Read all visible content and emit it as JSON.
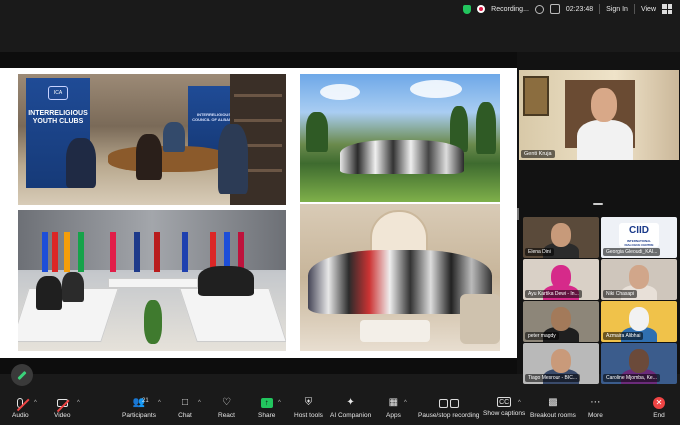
{
  "topbar": {
    "recording_label": "Recording...",
    "timer": "02:23:48",
    "sign_in": "Sign In",
    "view": "View"
  },
  "slide": {
    "banner_left_logo": "ICA",
    "banner_left_text": "INTERRELIGIOUS YOUTH CLUBS",
    "banner_right_text": "INTERRELIGIOUS COUNCIL OF ALBANIA"
  },
  "spotlight": {
    "name": "Genti Kruja"
  },
  "participants": [
    {
      "name": "Elena Dini",
      "bg": "#5a4a3a",
      "face": "#c79a7a",
      "body": "#2b2b2b"
    },
    {
      "name": "Georgia Gleoudi_KAI...",
      "bg": "#eef1f6",
      "logo": "CIID",
      "logo_sub": "INTERNATIONAL DIALOGUE CENTRE"
    },
    {
      "name": "Ayu Kartika Dewi - In...",
      "bg": "#d9d0c6",
      "face": "#d62a8a",
      "body": "#d62a8a"
    },
    {
      "name": "Niki Chasapi",
      "bg": "#cfc6bc",
      "face": "#d1a68a",
      "body": "#e8e0d8"
    },
    {
      "name": "peter magdy",
      "bg": "#8d8679",
      "face": "#a37a5a",
      "body": "#1f1f1f"
    },
    {
      "name": "Azmaira Alibhai",
      "bg": "#f0c24a",
      "face": "#f2f2f2",
      "body": "#2f6fb0"
    },
    {
      "name": "Tiago Mesrour - BIC...",
      "bg": "#b9b9b9",
      "face": "#c99a7a",
      "body": "#3a4b6b"
    },
    {
      "name": "Caroline Mjomba, Ke...",
      "bg": "#3b5c8c",
      "face": "#6b4a3a",
      "body": "#6b2b7a"
    }
  ],
  "toolbar": {
    "audio": "Audio",
    "video": "Video",
    "participants": "Participants",
    "participants_count": "21",
    "chat": "Chat",
    "react": "React",
    "share": "Share",
    "host_tools": "Host tools",
    "ai_companion": "AI Companion",
    "apps": "Apps",
    "pause_stop": "Pause/stop recording",
    "captions": "Show captions",
    "breakout": "Breakout rooms",
    "more": "More",
    "end": "End"
  },
  "colors": {
    "accent_green": "#22c55e",
    "end_red": "#ef4444",
    "bg": "#1a1a1a"
  }
}
